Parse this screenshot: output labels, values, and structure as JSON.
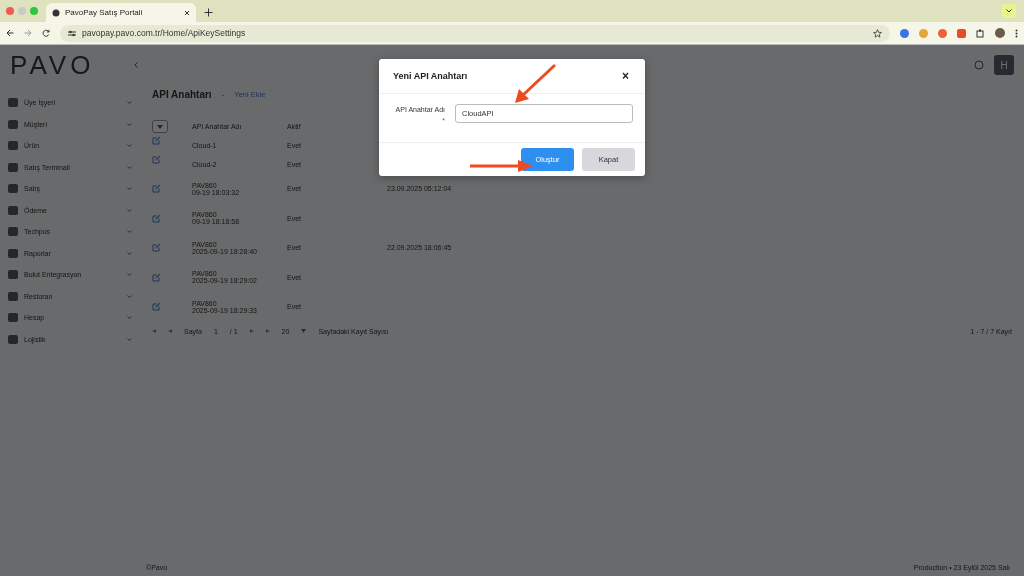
{
  "browser": {
    "tab_title": "PavoPay Satış Portali",
    "url": "pavopay.pavo.com.tr/Home/ApiKeySettings"
  },
  "header": {
    "logo": "PAVO",
    "avatar": "H"
  },
  "sidebar": {
    "items": [
      {
        "label": "Üye İşyeri"
      },
      {
        "label": "Müşteri"
      },
      {
        "label": "Ürün"
      },
      {
        "label": "Satış Terminali"
      },
      {
        "label": "Satış"
      },
      {
        "label": "Ödeme"
      },
      {
        "label": "Techpos"
      },
      {
        "label": "Raporlar"
      },
      {
        "label": "Bulut Entegrasyon"
      },
      {
        "label": "Restoran"
      },
      {
        "label": "Hesap"
      },
      {
        "label": "Lojistik"
      }
    ]
  },
  "page": {
    "title": "API Anahtarı",
    "separator": "-",
    "add_link": "Yeni Ekle"
  },
  "table": {
    "columns": [
      "API Anahtar Adı",
      "Aktif"
    ],
    "rows": [
      {
        "name": [
          "Cloud-1"
        ],
        "active": "Evet",
        "date": ""
      },
      {
        "name": [
          "Cloud-2"
        ],
        "active": "Evet",
        "date": ""
      },
      {
        "name": [
          "PAV860",
          "09-19 18:03:32"
        ],
        "active": "Evet",
        "date": "23.09.2025 05:12:04"
      },
      {
        "name": [
          "PAV860",
          "09-19 18:18:58"
        ],
        "active": "Evet",
        "date": ""
      },
      {
        "name": [
          "PAV860",
          "2025-09-19 18:28:40"
        ],
        "active": "Evet",
        "date": "22.09.2025 18:06:45"
      },
      {
        "name": [
          "PAV860",
          "2025-09-19 18:29:02"
        ],
        "active": "Evet",
        "date": ""
      },
      {
        "name": [
          "PAV860",
          "2025-09-19 18:29:33"
        ],
        "active": "Evet",
        "date": ""
      }
    ]
  },
  "pager": {
    "page_label": "Sayfa",
    "page": "1",
    "total": "/ 1",
    "page_size": "20",
    "page_size_label": "Sayfadaki Kayıt Sayısı",
    "summary": "1 - 7 / 7 Kayıt"
  },
  "footer": {
    "left": "©Pavo",
    "right": "Production • 23 Eylül 2025 Salı"
  },
  "modal": {
    "title": "Yeni API Anahtarı",
    "close": "×",
    "field_label": "API Anahtar Adı",
    "required": "*",
    "value": "CloudAPI",
    "buttons": [
      {
        "label": "Oluştur",
        "kind": "primary"
      },
      {
        "label": "Kapat",
        "kind": "secondary"
      }
    ]
  }
}
